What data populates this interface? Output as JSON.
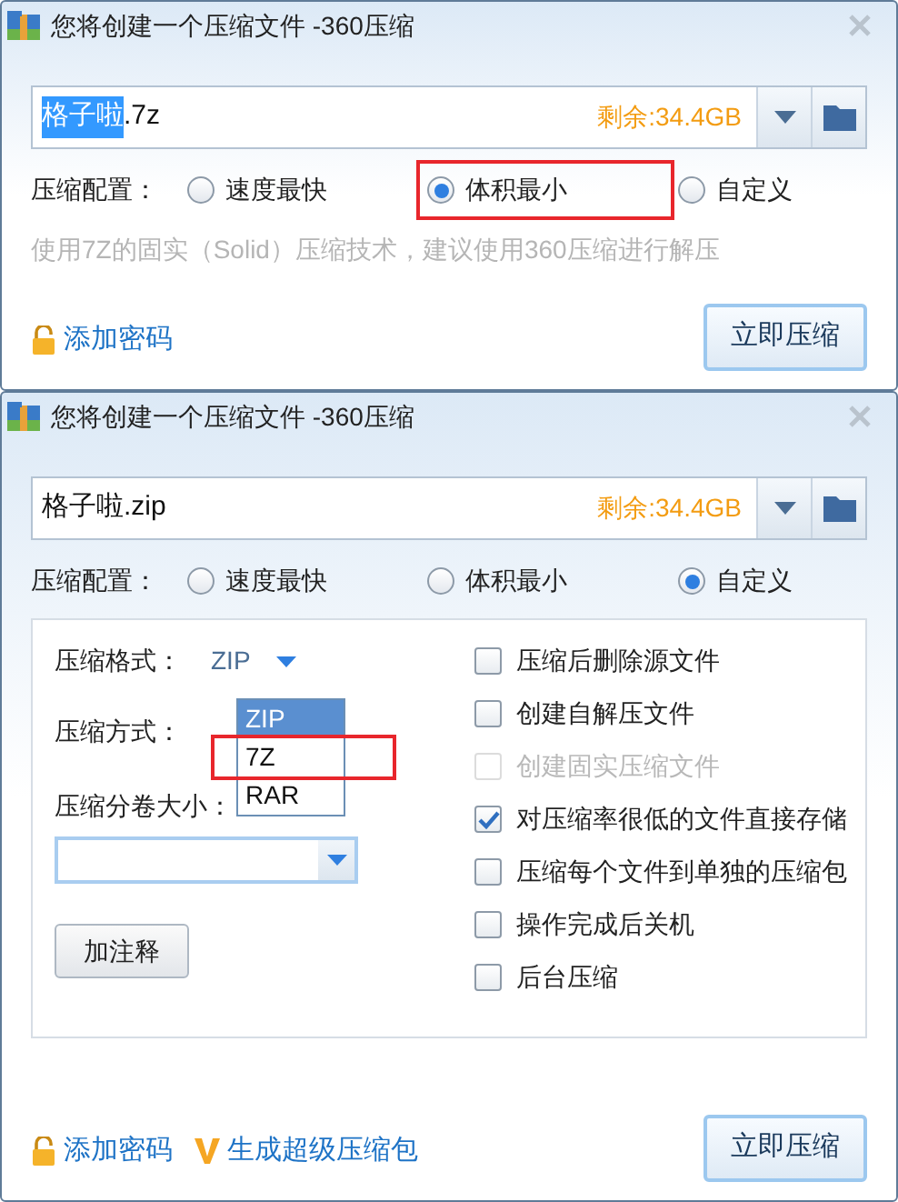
{
  "dialogs": [
    {
      "title": "您将创建一个压缩文件 -360压缩",
      "filename": [
        {
          "text": "格子啦",
          "selected": true
        },
        {
          "text": ".7z",
          "selected": false
        }
      ],
      "free_space": "剩余:34.4GB",
      "profile_label": "压缩配置：",
      "profiles": [
        {
          "label": "速度最快",
          "selected": false,
          "highlighted": false
        },
        {
          "label": "体积最小",
          "selected": true,
          "highlighted": true
        },
        {
          "label": "自定义",
          "selected": false,
          "highlighted": false
        }
      ],
      "hint": "使用7Z的固实（Solid）压缩技术，建议使用360压缩进行解压",
      "links": [
        {
          "kind": "lock",
          "text": "添加密码"
        }
      ],
      "submit": "立即压缩"
    },
    {
      "title": "您将创建一个压缩文件 -360压缩",
      "filename": [
        {
          "text": "格子啦.zip",
          "selected": false
        }
      ],
      "free_space": "剩余:34.4GB",
      "profile_label": "压缩配置：",
      "profiles": [
        {
          "label": "速度最快",
          "selected": false,
          "highlighted": false
        },
        {
          "label": "体积最小",
          "selected": false,
          "highlighted": false
        },
        {
          "label": "自定义",
          "selected": true,
          "highlighted": false
        }
      ],
      "custom": {
        "format_label": "压缩格式：",
        "format_value": "ZIP",
        "format_options": [
          {
            "label": "ZIP",
            "selected": true,
            "highlighted": false
          },
          {
            "label": "7Z",
            "selected": false,
            "highlighted": true
          },
          {
            "label": "RAR",
            "selected": false,
            "highlighted": false
          }
        ],
        "method_label": "压缩方式：",
        "volume_label": "压缩分卷大小：",
        "comment_button": "加注释",
        "options": [
          {
            "label": "压缩后删除源文件",
            "checked": false,
            "disabled": false
          },
          {
            "label": "创建自解压文件",
            "checked": false,
            "disabled": false
          },
          {
            "label": "创建固实压缩文件",
            "checked": false,
            "disabled": true
          },
          {
            "label": "对压缩率很低的文件直接存储",
            "checked": true,
            "disabled": false
          },
          {
            "label": "压缩每个文件到单独的压缩包",
            "checked": false,
            "disabled": false
          },
          {
            "label": "操作完成后关机",
            "checked": false,
            "disabled": false
          },
          {
            "label": "后台压缩",
            "checked": false,
            "disabled": false
          }
        ]
      },
      "links": [
        {
          "kind": "lock",
          "text": "添加密码"
        },
        {
          "kind": "v",
          "text": "生成超级压缩包"
        }
      ],
      "submit": "立即压缩"
    }
  ]
}
